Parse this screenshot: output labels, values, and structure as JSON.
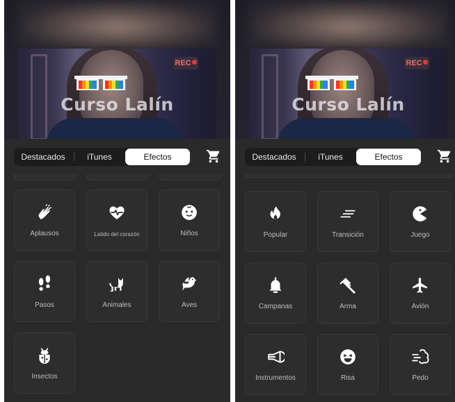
{
  "watermark": "Curso Lalín",
  "rec_badge": "REC",
  "tabs": [
    "Destacados",
    "iTunes",
    "Efectos"
  ],
  "active_tab": "Efectos",
  "left_panel": {
    "items": [
      {
        "label": "Aplausos",
        "icon": "clap-icon"
      },
      {
        "label": "Latido del corazón",
        "icon": "heartbeat-icon"
      },
      {
        "label": "Niños",
        "icon": "baby-icon"
      },
      {
        "label": "Pasos",
        "icon": "footsteps-icon"
      },
      {
        "label": "Animales",
        "icon": "cat-icon"
      },
      {
        "label": "Aves",
        "icon": "bird-icon"
      },
      {
        "label": "Insectos",
        "icon": "bug-icon"
      }
    ]
  },
  "right_panel": {
    "items": [
      {
        "label": "Popular",
        "icon": "flame-icon"
      },
      {
        "label": "Transición",
        "icon": "transition-icon"
      },
      {
        "label": "Juego",
        "icon": "pacman-icon"
      },
      {
        "label": "Campanas",
        "icon": "bell-icon"
      },
      {
        "label": "Arma",
        "icon": "hammer-icon"
      },
      {
        "label": "Avión",
        "icon": "airplane-icon"
      },
      {
        "label": "Instrumentos",
        "icon": "horn-icon"
      },
      {
        "label": "Risa",
        "icon": "laugh-icon"
      },
      {
        "label": "Pedo",
        "icon": "fart-icon"
      }
    ]
  },
  "colors": {
    "background": "#2a2a2a",
    "card": "#2d2d2d",
    "active_tab": "#ffffff",
    "icon": "#ffffff"
  }
}
